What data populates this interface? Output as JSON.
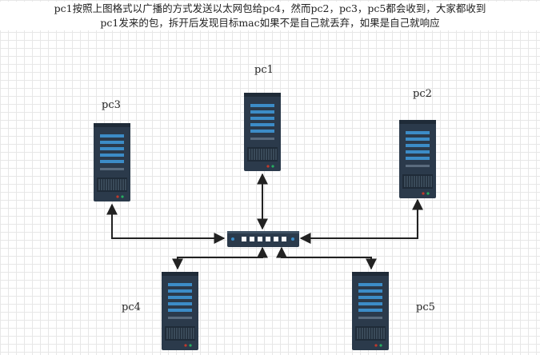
{
  "caption": {
    "line1": "pc1按照上图格式以广播的方式发送以太网包给pc4，然而pc2，pc3，pc5都会收到，大家都收到",
    "line2": "pc1发来的包，拆开后发现目标mac如果不是自己就丢弃，如果是自己就响应"
  },
  "nodes": {
    "pc1": "pc1",
    "pc2": "pc2",
    "pc3": "pc3",
    "pc4": "pc4",
    "pc5": "pc5"
  },
  "colors": {
    "server_body": "#2b3a4b",
    "server_dark": "#1f2b38",
    "server_light": "#3c8cc7",
    "switch_body": "#2b3a4b",
    "arrow": "#222222"
  },
  "icons": [
    "server-icon",
    "switch-icon"
  ]
}
